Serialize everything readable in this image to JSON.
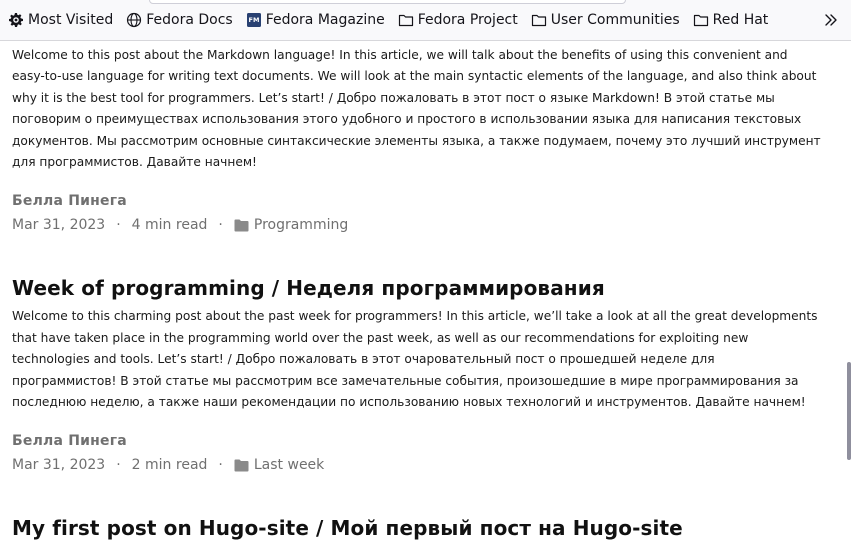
{
  "bookmarks": [
    {
      "label": "Most Visited",
      "icon": "gear-icon"
    },
    {
      "label": "Fedora Docs",
      "icon": "globe-icon"
    },
    {
      "label": "Fedora Magazine",
      "icon": "fedora-magazine-icon"
    },
    {
      "label": "Fedora Project",
      "icon": "folder-icon"
    },
    {
      "label": "User Communities",
      "icon": "folder-icon"
    },
    {
      "label": "Red Hat",
      "icon": "folder-icon"
    }
  ],
  "posts": [
    {
      "title": "",
      "description": "Welcome to this post about the Markdown language! In this article, we will talk about the benefits of using this convenient and easy-to-use language for writing text documents. We will look at the main syntactic elements of the language, and also think about why it is the best tool for programmers. Let’s start! / Добро пожаловать в этот пост о языке Markdown! В этой статье мы поговорим о преимуществах использования этого удобного и простого в использовании языка для написания текстовых документов. Мы рассмотрим основные синтаксические элементы языка, а также подумаем, почему это лучший инструмент для программистов. Давайте начнем!",
      "author": "Белла Пинега",
      "date": "Mar 31, 2023",
      "read_time": "4 min read",
      "category": "Programming"
    },
    {
      "title": "Week of programming / Неделя программирования",
      "description": "Welcome to this charming post about the past week for programmers! In this article, we’ll take a look at all the great developments that have taken place in the programming world over the past week, as well as our recommendations for exploiting new technologies and tools. Let’s start! / Добро пожаловать в этот очаровательный пост о прошедшей неделе для программистов! В этой статье мы рассмотрим все замечательные события, произошедшие в мире программирования за последнюю неделю, а также наши рекомендации по использованию новых технологий и инструментов. Давайте начнем!",
      "author": "Белла Пинега",
      "date": "Mar 31, 2023",
      "read_time": "2 min read",
      "category": "Last week"
    },
    {
      "title": "My first post on Hugo-site / Мой первый пост на Hugo-site",
      "description": "",
      "author": "",
      "date": "",
      "read_time": "",
      "category": ""
    }
  ],
  "meta_separator": "·"
}
